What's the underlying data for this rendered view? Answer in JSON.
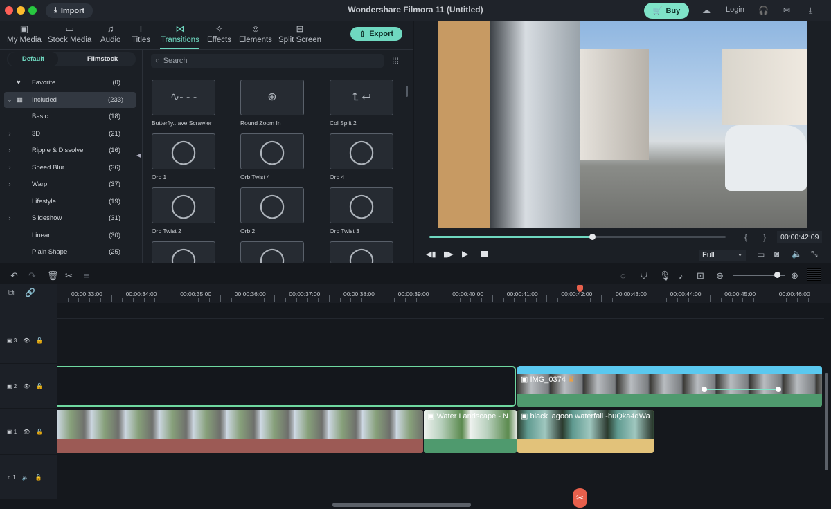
{
  "titlebar": {
    "title": "Wondershare Filmora 11 (Untitled)",
    "import_label": "Import",
    "buy_label": "Buy",
    "login_label": "Login"
  },
  "nav": {
    "tabs": [
      {
        "label": "My Media",
        "icon": "image-icon"
      },
      {
        "label": "Stock Media",
        "icon": "cloud-folder-icon"
      },
      {
        "label": "Audio",
        "icon": "music-note-icon"
      },
      {
        "label": "Titles",
        "icon": "text-icon"
      },
      {
        "label": "Transitions",
        "icon": "transition-icon"
      },
      {
        "label": "Effects",
        "icon": "sparkle-icon"
      },
      {
        "label": "Elements",
        "icon": "smiley-icon"
      },
      {
        "label": "Split Screen",
        "icon": "split-screen-icon"
      }
    ],
    "active": "Transitions",
    "export_label": "Export"
  },
  "segment": {
    "default": "Default",
    "filmstock": "Filmstock"
  },
  "sidebar": {
    "items": [
      {
        "label": "Favorite",
        "count": "(0)"
      },
      {
        "label": "Included",
        "count": "(233)"
      },
      {
        "label": "Basic",
        "count": "(18)"
      },
      {
        "label": "3D",
        "count": "(21)"
      },
      {
        "label": "Ripple & Dissolve",
        "count": "(16)"
      },
      {
        "label": "Speed Blur",
        "count": "(36)"
      },
      {
        "label": "Warp",
        "count": "(37)"
      },
      {
        "label": "Lifestyle",
        "count": "(19)"
      },
      {
        "label": "Slideshow",
        "count": "(31)"
      },
      {
        "label": "Linear",
        "count": "(30)"
      },
      {
        "label": "Plain Shape",
        "count": "(25)"
      }
    ]
  },
  "search": {
    "placeholder": "Search"
  },
  "transitions": [
    "Butterfly...ave Scrawler",
    "Round Zoom In",
    "Col Split 2",
    "Orb 1",
    "Orb Twist 4",
    "Orb 4",
    "Orb Twist 2",
    "Orb 2",
    "Orb Twist 3"
  ],
  "player": {
    "timecode": "00:00:42:09",
    "progress": 0.55,
    "quality": "Full",
    "mark_in": "{",
    "mark_out": "}"
  },
  "timeline": {
    "ruler": [
      "00:00:33:00",
      "00:00:34:00",
      "00:00:35:00",
      "00:00:36:00",
      "00:00:37:00",
      "00:00:38:00",
      "00:00:39:00",
      "00:00:40:00",
      "00:00:41:00",
      "00:00:42:00",
      "00:00:43:00",
      "00:00:44:00",
      "00:00:45:00",
      "00:00:46:00"
    ],
    "zoom_level": 0.85,
    "tracks": [
      {
        "label": "3",
        "type": "video"
      },
      {
        "label": "2",
        "type": "video"
      },
      {
        "label": "1",
        "type": "video"
      },
      {
        "label": "1",
        "type": "audio"
      }
    ],
    "clips": {
      "img": "IMG_0374",
      "water": "Water Landscape - N",
      "lagoon": "black lagoon waterfall -buQka4dWa"
    }
  },
  "colors": {
    "accent": "#6fd8c0",
    "playhead": "#e8604c",
    "clip_blue": "#5ac8ef",
    "clip_green": "#4f9a6e",
    "clip_yellow": "#e2c27a",
    "clip_red": "#9c5a55"
  }
}
